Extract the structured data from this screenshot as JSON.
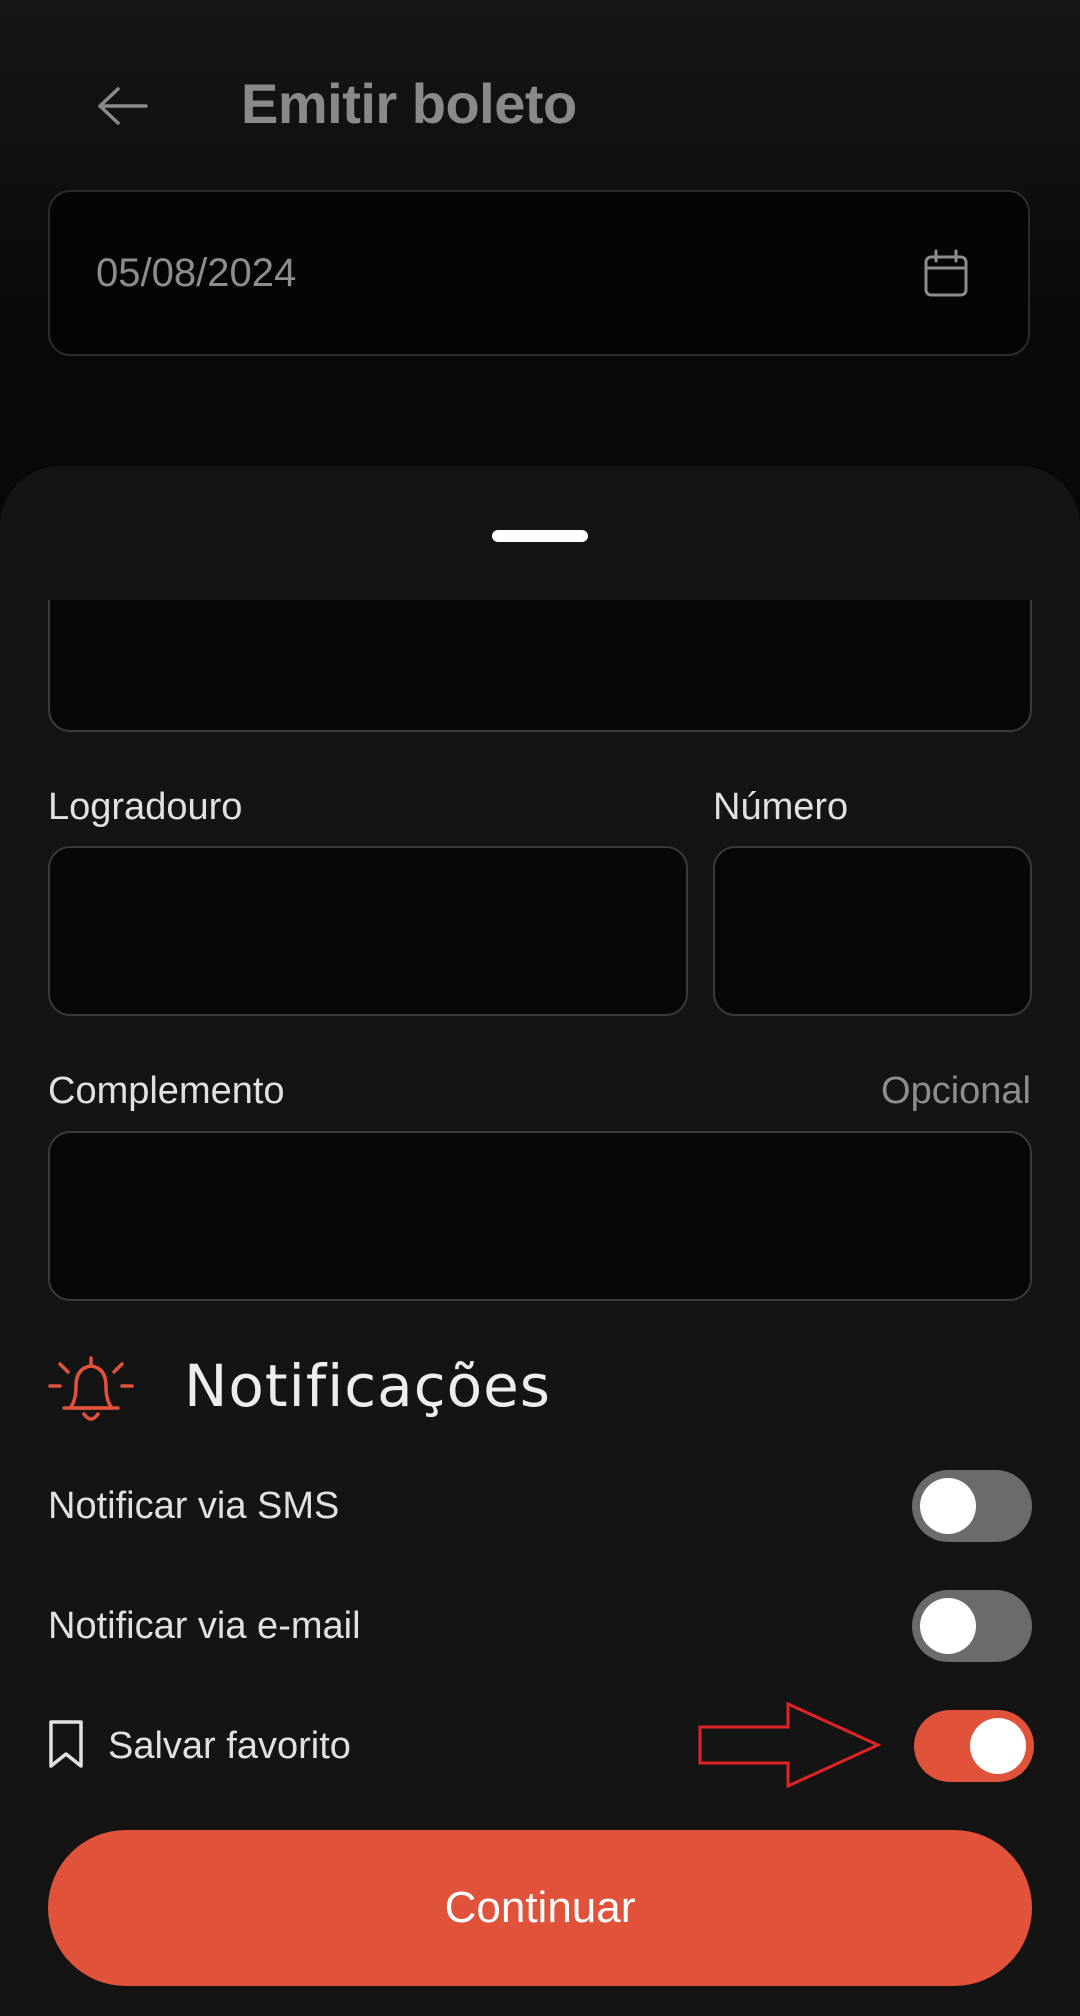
{
  "header": {
    "title": "Emitir boleto",
    "back_icon": "arrow-left-icon"
  },
  "date_field": {
    "value": "05/08/2024",
    "icon": "calendar-icon"
  },
  "address": {
    "logradouro_label": "Logradouro",
    "numero_label": "Número",
    "complemento_label": "Complemento",
    "complemento_hint": "Opcional"
  },
  "notifications": {
    "title": "Notificações",
    "icon": "bell-icon",
    "sms_label": "Notificar via SMS",
    "sms_enabled": false,
    "email_label": "Notificar via e-mail",
    "email_enabled": false
  },
  "favorite": {
    "label": "Salvar favorito",
    "icon": "bookmark-icon",
    "enabled": true
  },
  "continue_label": "Continuar",
  "colors": {
    "accent": "#e0523a",
    "toggle_off": "#6b6b6d",
    "annotation": "#e02424"
  }
}
